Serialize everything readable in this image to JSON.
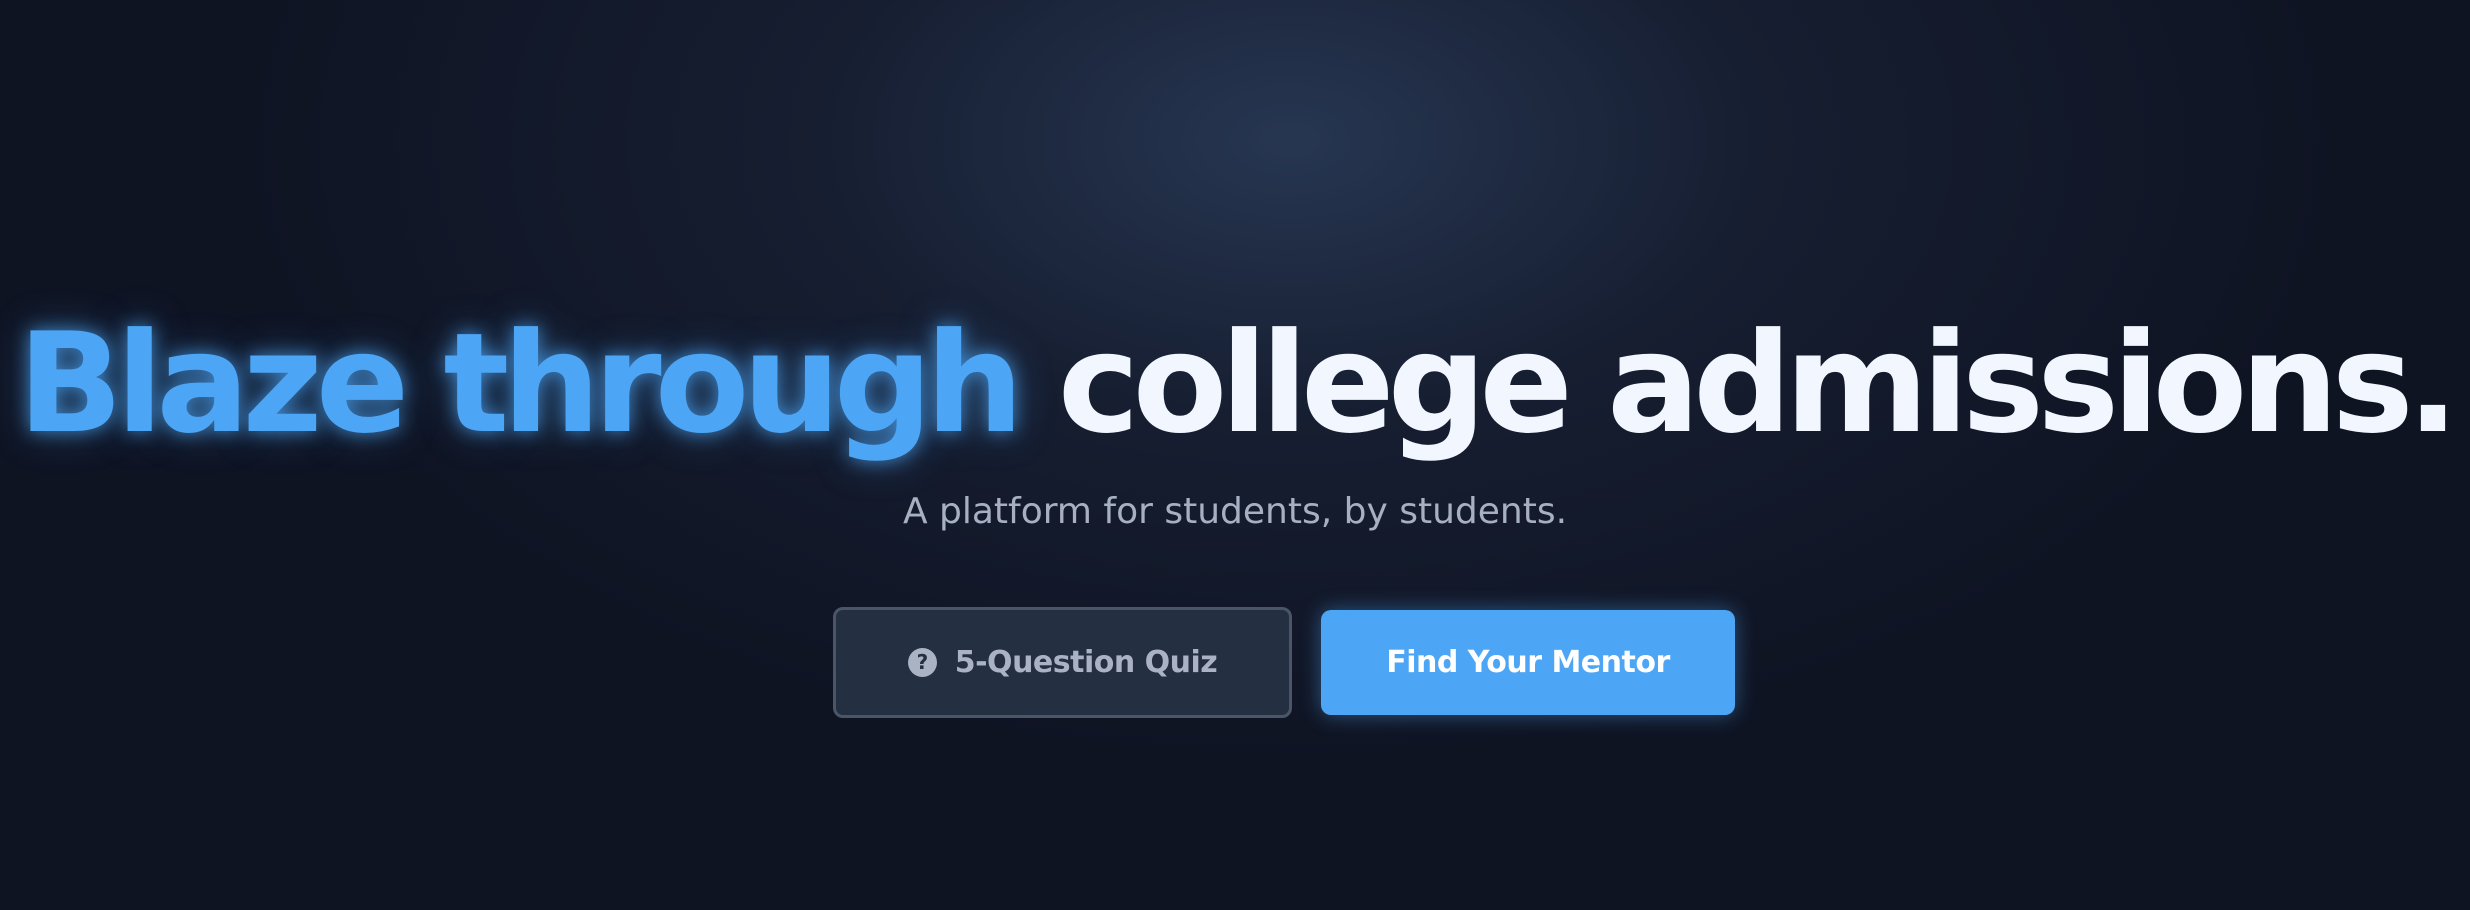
{
  "hero": {
    "headline_accent": "Blaze through",
    "headline_main": "college admissions.",
    "subtitle": "A platform for students, by students."
  },
  "buttons": {
    "quiz_label": "5-Question Quiz",
    "quiz_icon": "question-circle-icon",
    "mentor_label": "Find Your Mentor"
  },
  "colors": {
    "background": "#0f1423",
    "accent": "#4da6f5",
    "headline_text": "#f1f6ff",
    "subtitle_text": "#a7b0c2",
    "secondary_button_bg": "#252f42",
    "secondary_button_border": "#4a5568"
  }
}
